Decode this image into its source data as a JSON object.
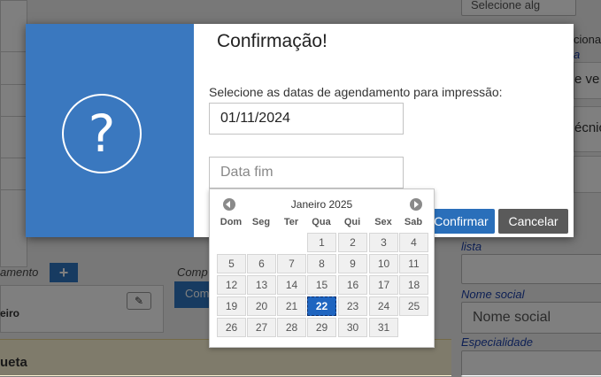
{
  "background": {
    "top_right_select": "Selecione alg",
    "side_frag_1": "cionai",
    "side_frag_2": "a",
    "side_frag_3": "e ve",
    "side_frag_4": "écnic",
    "left_label_agendamento": "amento",
    "left_text_eiro": "eiro",
    "left_text_componente": "Comp",
    "left_button_com": "Com",
    "bottom_left_text": "ueta",
    "label_lista": "lista",
    "label_nome_social": "Nome social",
    "input_nome_social_placeholder": "Nome social",
    "label_especialidade": "Especialidade"
  },
  "modal": {
    "title": "Confirmação!",
    "icon": "question-icon",
    "prompt": "Selecione as datas de agendamento para impressão:",
    "start_date_value": "01/11/2024",
    "end_date_placeholder": "Data fim",
    "confirm_label": "Confirmar",
    "cancel_label": "Cancelar",
    "accent_color": "#3a78bf"
  },
  "datepicker": {
    "month_label": "Janeiro 2025",
    "weekdays": [
      "Dom",
      "Seg",
      "Ter",
      "Qua",
      "Qui",
      "Sex",
      "Sab"
    ],
    "first_weekday_index": 3,
    "days_in_month": 31,
    "selected_day": 22,
    "selected_color": "#1f65c0"
  }
}
